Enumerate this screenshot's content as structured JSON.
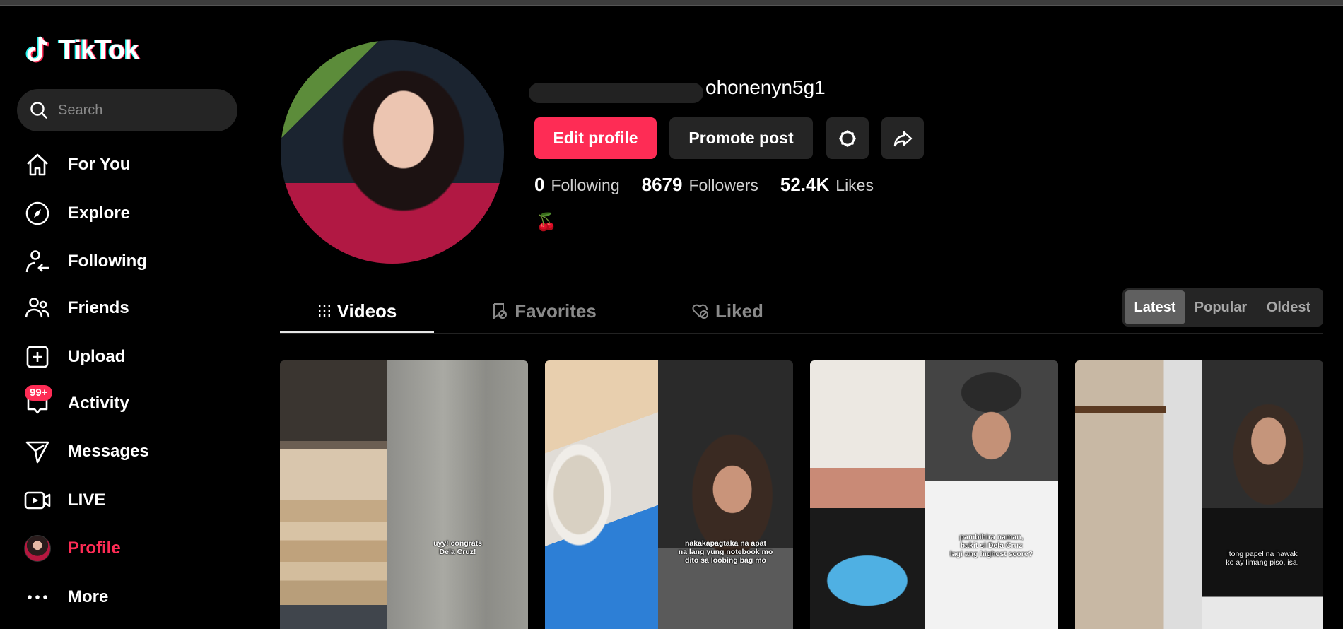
{
  "app": {
    "name": "TikTok",
    "brand_color": "#fe2c55",
    "logo_cyan": "#25f4ee"
  },
  "search": {
    "placeholder": "Search",
    "value": ""
  },
  "sidebar": {
    "items": [
      {
        "label": "For You",
        "icon": "home-icon"
      },
      {
        "label": "Explore",
        "icon": "compass-icon"
      },
      {
        "label": "Following",
        "icon": "user-follow-icon"
      },
      {
        "label": "Friends",
        "icon": "friends-icon"
      },
      {
        "label": "Upload",
        "icon": "plus-square-icon"
      },
      {
        "label": "Activity",
        "icon": "message-bubble-icon",
        "badge": "99+"
      },
      {
        "label": "Messages",
        "icon": "paper-plane-icon"
      },
      {
        "label": "LIVE",
        "icon": "live-camera-icon"
      },
      {
        "label": "Profile",
        "icon": "avatar",
        "active": true
      },
      {
        "label": "More",
        "icon": "more-dots-icon"
      }
    ]
  },
  "profile": {
    "username_visible": "ohonenyn5g1",
    "username_redacted": true,
    "buttons": {
      "edit_profile": "Edit profile",
      "promote_post": "Promote post",
      "settings_icon": "gear-icon",
      "share_icon": "share-icon"
    },
    "stats": [
      {
        "value": "0",
        "label": "Following"
      },
      {
        "value": "8679",
        "label": "Followers"
      },
      {
        "value": "52.4K",
        "label": "Likes"
      }
    ],
    "bio": "🍒"
  },
  "tabs": [
    {
      "label": "Videos",
      "icon": "grid-icon",
      "active": true
    },
    {
      "label": "Favorites",
      "icon": "bookmark-lock-icon",
      "active": false
    },
    {
      "label": "Liked",
      "icon": "heart-lock-icon",
      "active": false
    }
  ],
  "sort": {
    "options": [
      "Latest",
      "Popular",
      "Oldest"
    ],
    "selected": "Latest"
  },
  "videos": [
    {
      "caption": "uyy! congrats\nDela Cruz!"
    },
    {
      "caption": "nakakapagtaka na apat\nna lang yung notebook mo\ndito sa loobing bag mo"
    },
    {
      "caption": "pambihira naman,\nbakit si Dela Cruz\nlagi ang highest score?"
    },
    {
      "caption": "itong papel na hawak\nko ay limang piso, isa."
    }
  ]
}
